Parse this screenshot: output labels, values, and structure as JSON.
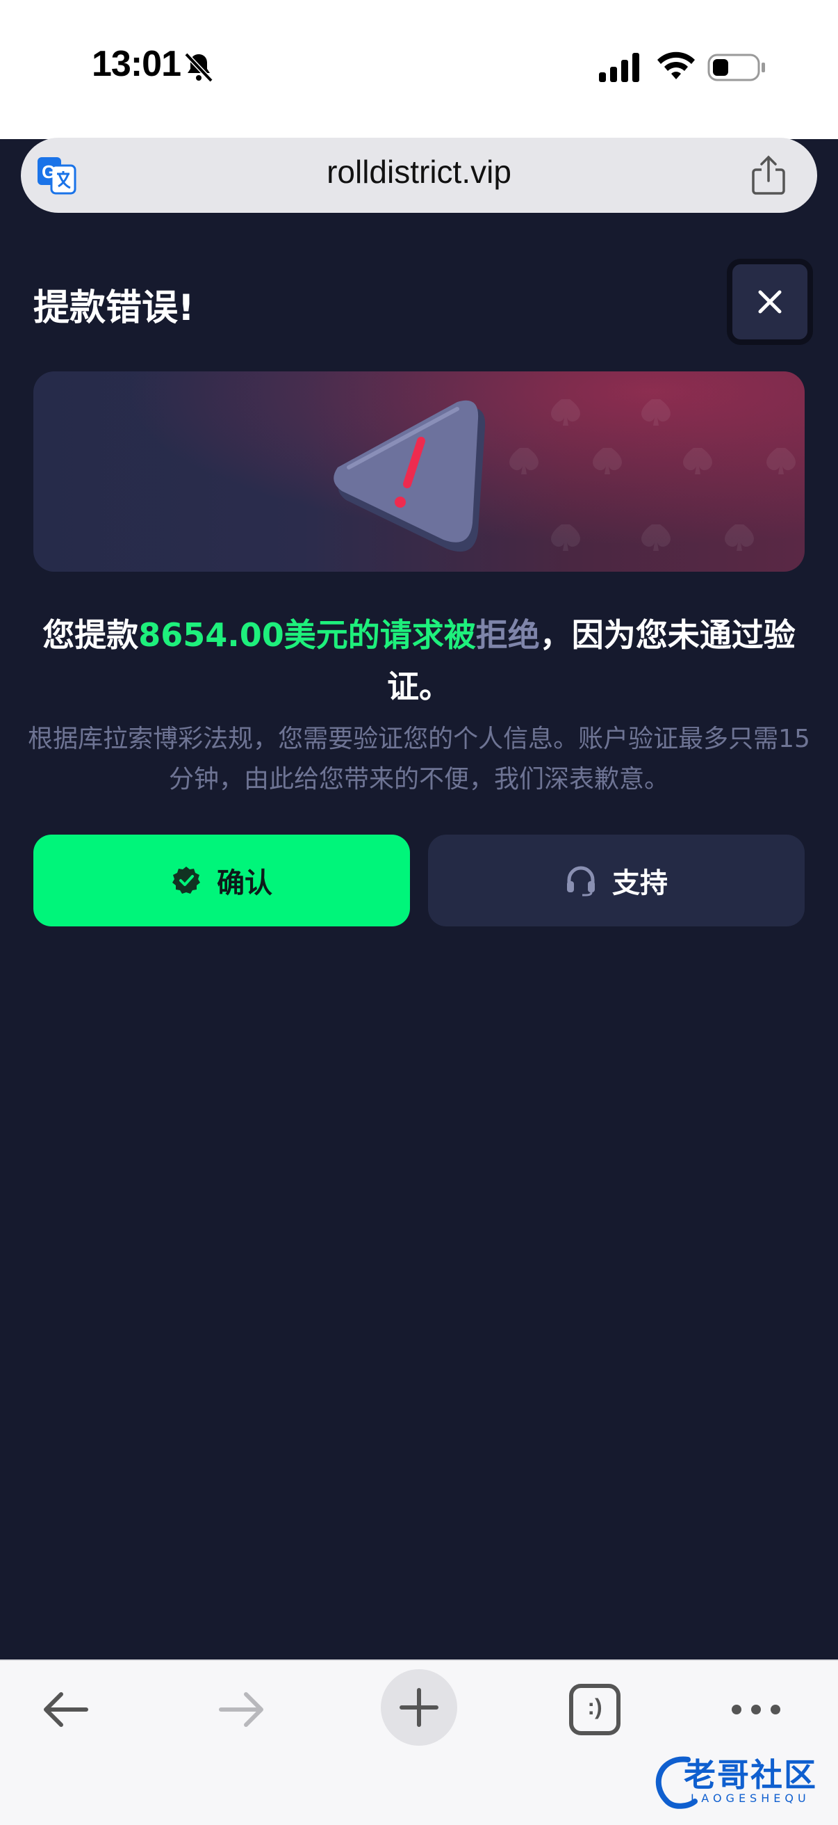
{
  "status_bar": {
    "time": "13:01",
    "icons": [
      "bell-slash-icon",
      "cellular-signal-icon",
      "wifi-icon",
      "battery-icon"
    ]
  },
  "browser": {
    "url": "rolldistrict.vip",
    "translate_icon": "translate-icon",
    "share_icon": "share-icon"
  },
  "dialog": {
    "title": "提款错误!",
    "close_icon": "close-icon",
    "message_prefix": "您提款",
    "message_amount": "8654.00美元的请求被",
    "message_rejected": "拒绝",
    "message_suffix": "，因为您未通过验证。",
    "subtext": "根据库拉索博彩法规，您需要验证您的个人信息。账户验证最多只需15分钟，由此给您带来的不便，我们深表歉意。",
    "confirm_label": "确认",
    "support_label": "支持",
    "colors": {
      "background": "#161a2e",
      "accent_green": "#00f57a",
      "muted_text": "#6e7494"
    }
  },
  "toolbar": {
    "icons": [
      "back-arrow-icon",
      "forward-arrow-icon",
      "new-tab-icon",
      "tabs-icon",
      "more-icon"
    ],
    "tabs_glyph": ":)"
  },
  "watermark": {
    "text": "老哥社区",
    "subtext": "LAOGESHEQU"
  }
}
